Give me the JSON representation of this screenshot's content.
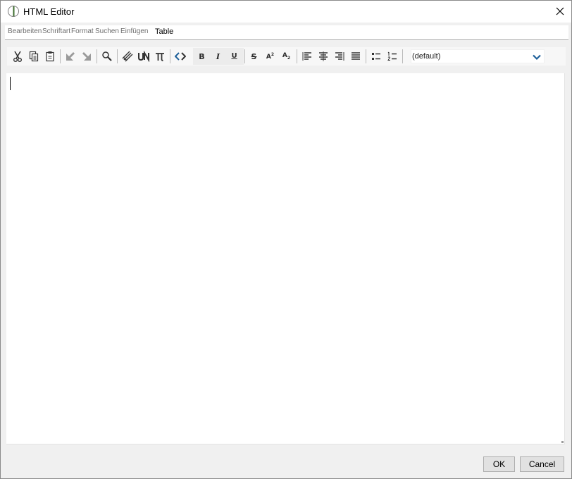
{
  "window": {
    "title": "HTML Editor",
    "close_label": "×"
  },
  "menubar": {
    "items": [
      "Bearbeiten",
      "Schriftart",
      "Format",
      "Suchen",
      "Einfügen",
      "Table"
    ]
  },
  "toolbar": {
    "buttons": [
      {
        "name": "cut-icon"
      },
      {
        "name": "copy-icon"
      },
      {
        "name": "paste-icon"
      },
      {
        "name": "undo-icon"
      },
      {
        "name": "redo-icon"
      },
      {
        "name": "search-icon"
      },
      {
        "name": "hyperlink-icon"
      },
      {
        "name": "unlink-icon"
      },
      {
        "name": "symbol-pi-icon"
      },
      {
        "name": "source-code-icon"
      }
    ],
    "text_format": {
      "bold": "B",
      "italic": "I",
      "underline": "U",
      "strike": "S",
      "superscript_base": "A",
      "superscript_exp": "2",
      "subscript_base": "A",
      "subscript_exp": "2"
    },
    "font_select": {
      "value": "(default)"
    }
  },
  "editor": {
    "content": ""
  },
  "buttons": {
    "ok": "OK",
    "cancel": "Cancel"
  },
  "colors": {
    "accent": "#1d5f99",
    "window_bg": "#f0f0f0",
    "editor_bg": "#ffffff"
  }
}
